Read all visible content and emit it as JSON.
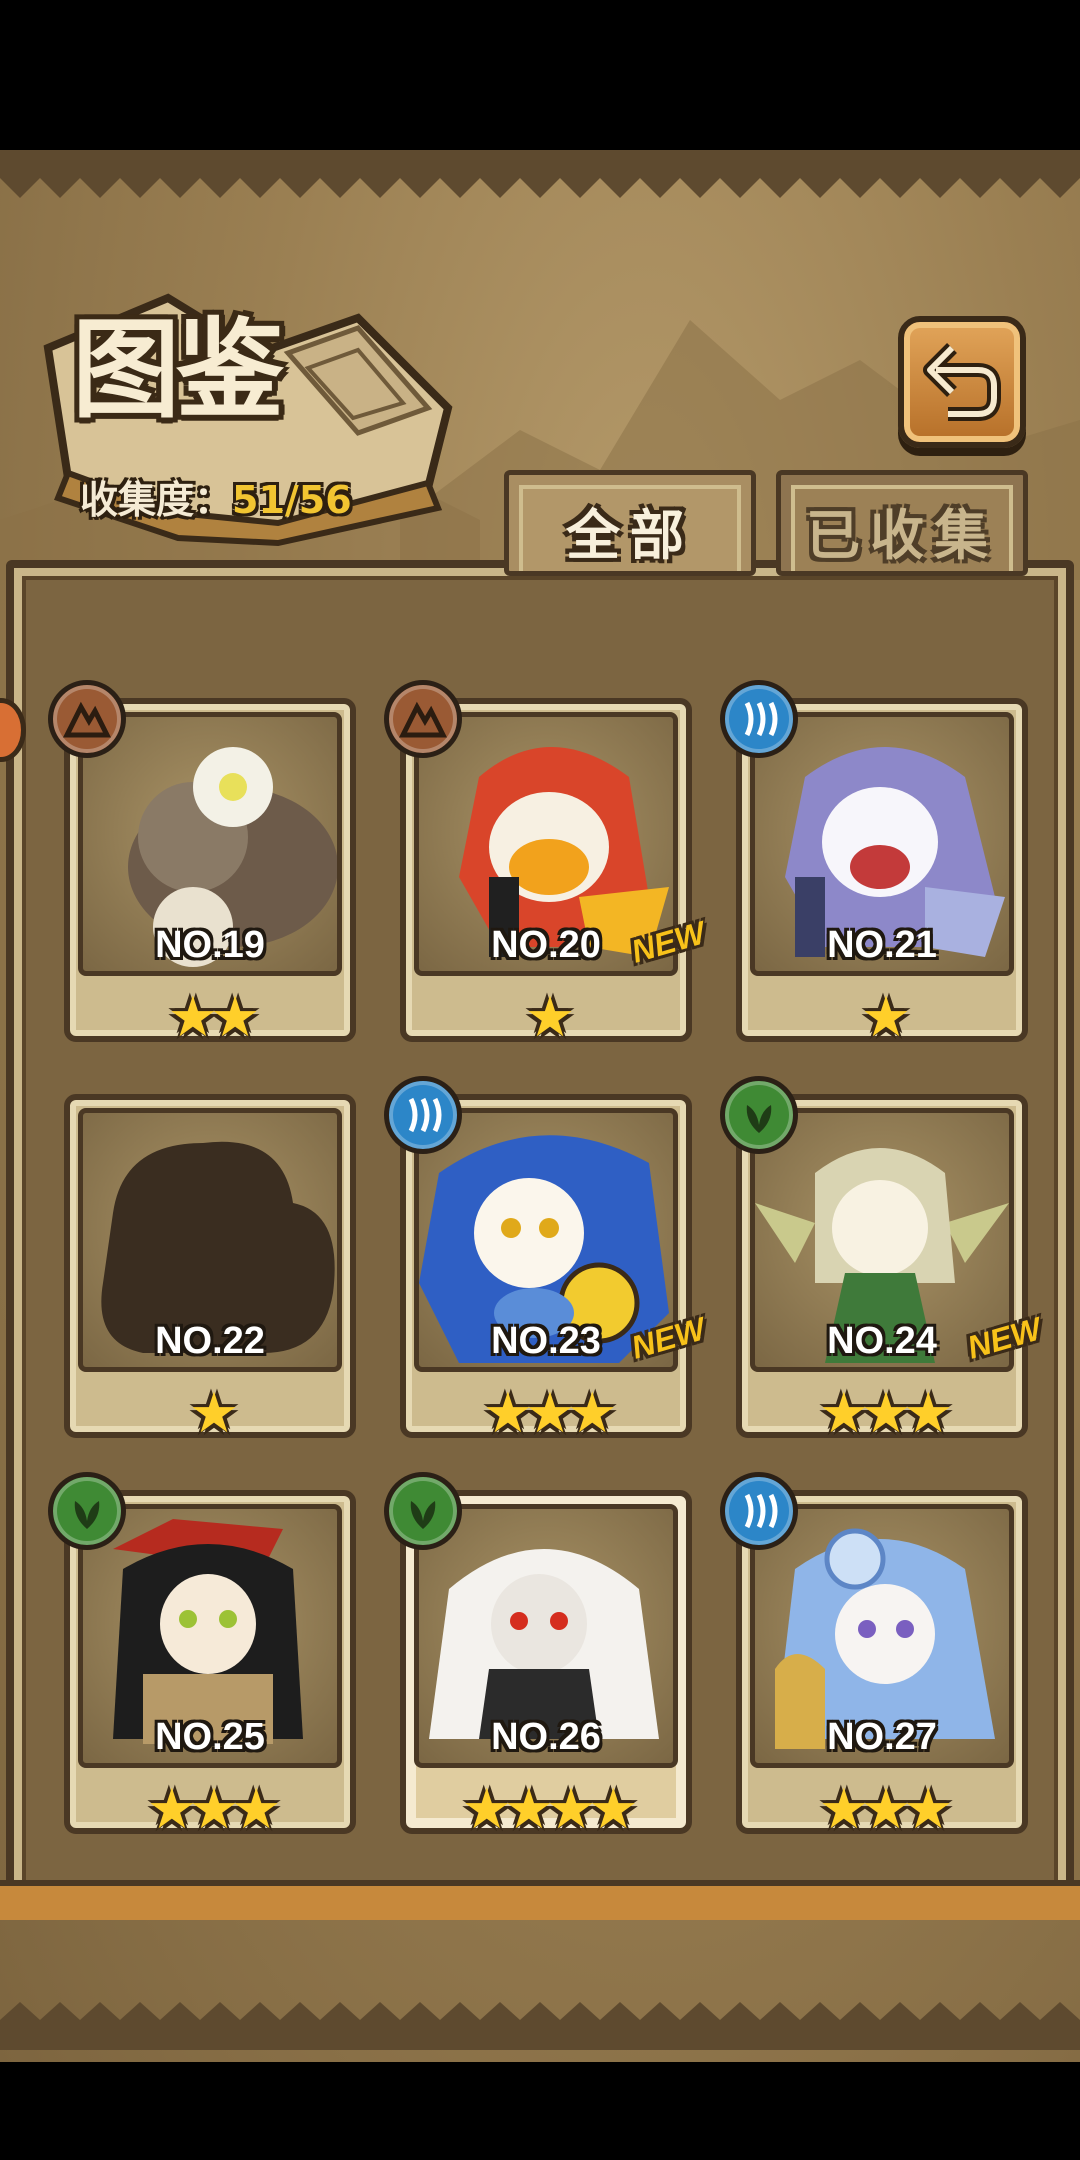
{
  "header": {
    "title": "图鉴",
    "collection_label": "收集度：",
    "collection_value": "51/56"
  },
  "tabs": {
    "all_label": "全部",
    "collected_label": "已收集"
  },
  "icons": {
    "back": "back-arrow-icon",
    "earth": "earth-element-icon",
    "water": "water-element-icon",
    "leaf": "leaf-element-icon"
  },
  "cards": [
    {
      "number": "NO.19",
      "stars": "★★",
      "element": "earth",
      "new": ""
    },
    {
      "number": "NO.20",
      "stars": "★",
      "element": "earth",
      "new": "NEW"
    },
    {
      "number": "NO.21",
      "stars": "★",
      "element": "water",
      "new": ""
    },
    {
      "number": "NO.22",
      "stars": "★",
      "element": "",
      "new": ""
    },
    {
      "number": "NO.23",
      "stars": "★★★",
      "element": "water",
      "new": "NEW"
    },
    {
      "number": "NO.24",
      "stars": "★★★",
      "element": "leaf",
      "new": "NEW"
    },
    {
      "number": "NO.25",
      "stars": "★★★",
      "element": "leaf",
      "new": ""
    },
    {
      "number": "NO.26",
      "stars": "★★★★",
      "element": "leaf",
      "new": ""
    },
    {
      "number": "NO.27",
      "stars": "★★★",
      "element": "water",
      "new": ""
    }
  ],
  "colors": {
    "parchment": "#9a7f52",
    "star": "#ffcf2a",
    "new_badge": "#f8c21a",
    "earth": "#9a5a34",
    "water": "#2c86c8",
    "leaf": "#3f8a34"
  }
}
